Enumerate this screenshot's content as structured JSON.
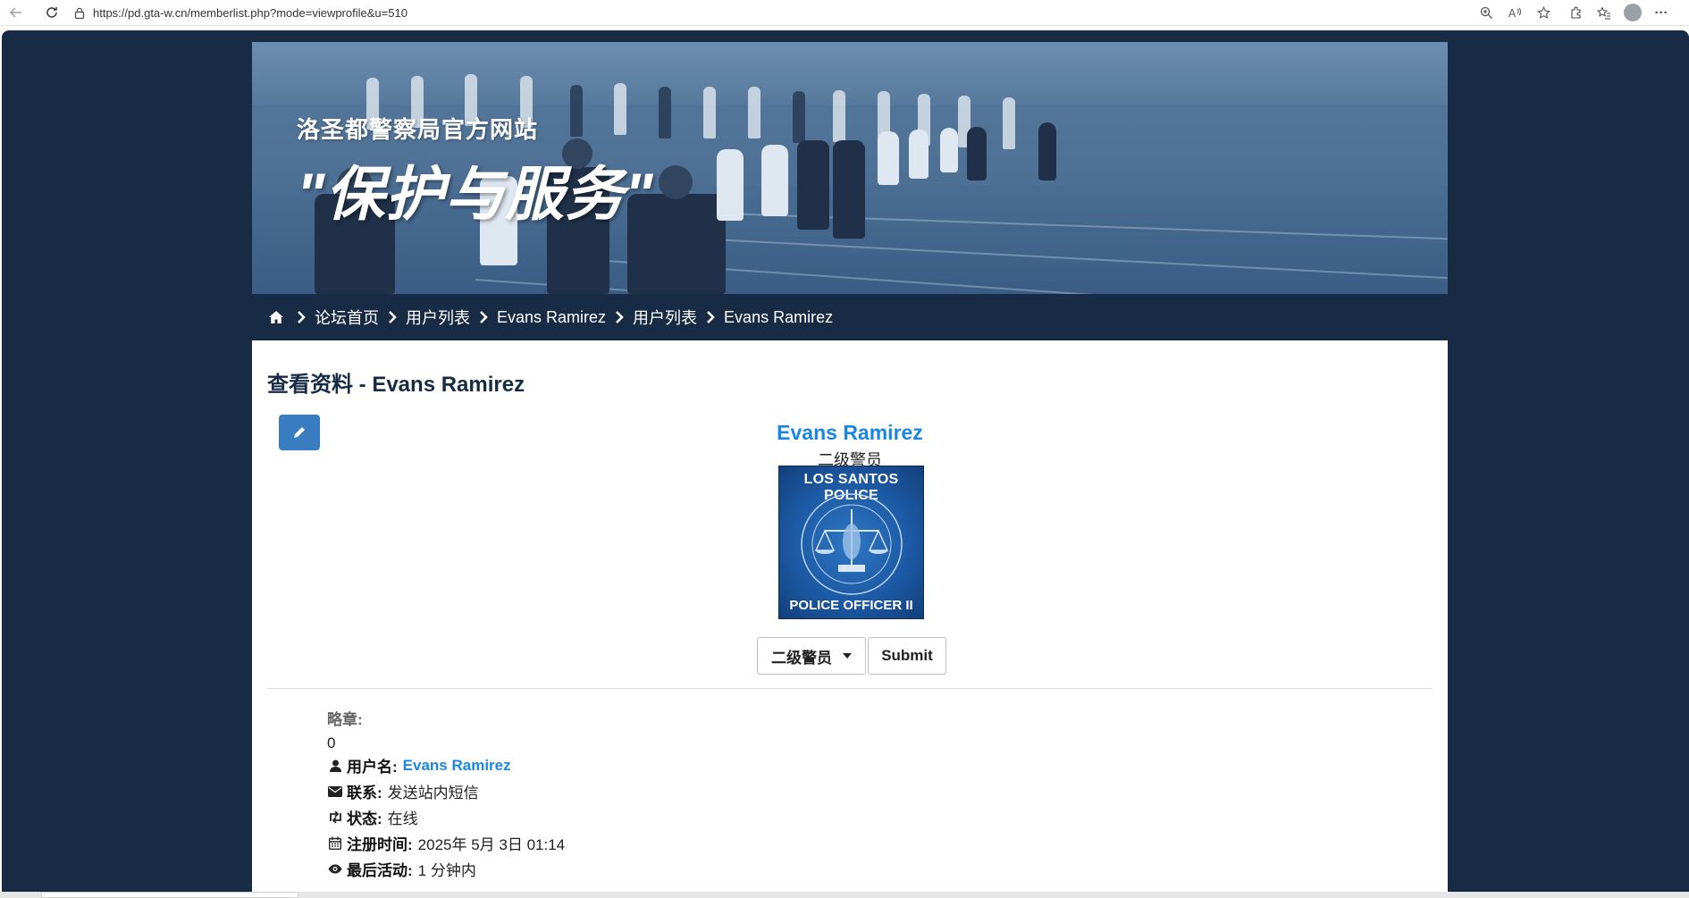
{
  "browser": {
    "url": "https://pd.gta-w.cn/memberlist.php?mode=viewprofile&u=510"
  },
  "banner": {
    "subtitle": "洛圣都警察局官方网站",
    "motto": "\"保护与服务\""
  },
  "breadcrumb": {
    "items": [
      "论坛首页",
      "用户列表",
      "Evans Ramirez",
      "用户列表",
      "Evans Ramirez"
    ]
  },
  "profile": {
    "page_title": "查看资料 - Evans Ramirez",
    "name": "Evans Ramirez",
    "rank": "二级警员",
    "badge": {
      "top_text": "LOS SANTOS POLICE",
      "bottom_text": "POLICE OFFICER II"
    },
    "rank_select_value": "二级警员",
    "submit_label": "Submit",
    "medal_label": "略章:",
    "medal_value": "0",
    "fields": [
      {
        "icon": "user-icon",
        "label": "用户名:",
        "value": "Evans Ramirez",
        "link": true
      },
      {
        "icon": "envelope-icon",
        "label": "联系:",
        "value": "发送站内短信",
        "link": false
      },
      {
        "icon": "retweet-icon",
        "label": "状态:",
        "value": "在线",
        "link": false
      },
      {
        "icon": "calendar-icon",
        "label": "注册时间:",
        "value": "2025年 5月 3日 01:14",
        "link": false
      },
      {
        "icon": "eye-icon",
        "label": "最后活动:",
        "value": "1 分钟内",
        "link": false
      }
    ]
  },
  "colors": {
    "page_bg": "#182b44",
    "link": "#1a86e3",
    "edit_button": "#3a7cc0"
  }
}
